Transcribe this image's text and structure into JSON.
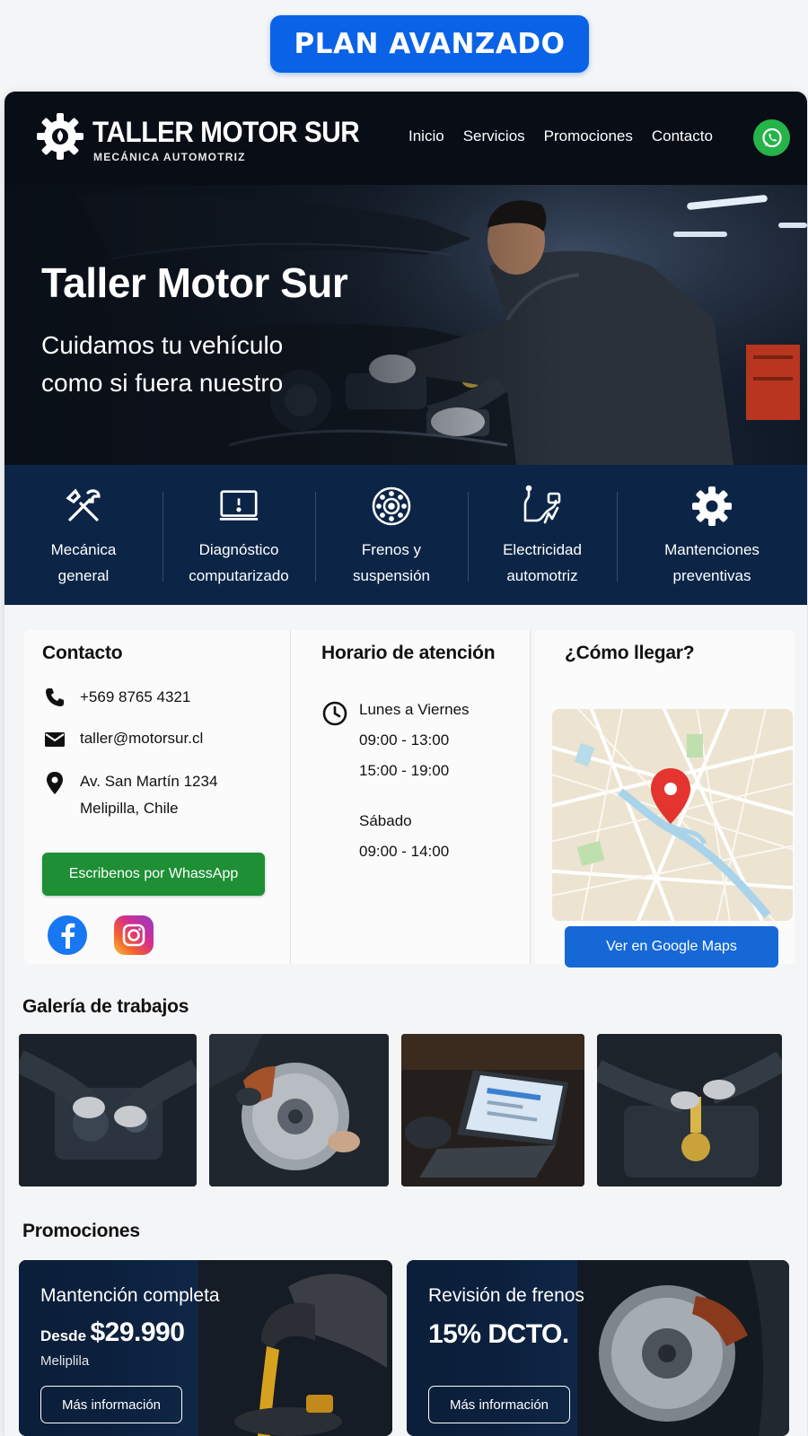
{
  "plan_badge": "PLAN AVANZADO",
  "header": {
    "brand": "TALLER MOTOR SUR",
    "brand_sub": "MECÁNICA AUTOMOTRIZ",
    "nav": [
      "Inicio",
      "Servicios",
      "Promociones",
      "Contacto"
    ],
    "whatsapp_icon": "whatsapp-icon"
  },
  "hero": {
    "title": "Taller Motor Sur",
    "subtitle": "Cuidamos tu vehículo como si fuera nuestro"
  },
  "services": [
    {
      "line1": "Mecánica",
      "line2": "general",
      "icon": "wrench-screwdriver-icon"
    },
    {
      "line1": "Diagnóstico",
      "line2": "computarizado",
      "icon": "laptop-diagnostic-icon"
    },
    {
      "line1": "Frenos y",
      "line2": "suspensión",
      "icon": "brake-disc-icon"
    },
    {
      "line1": "Electricidad",
      "line2": "automotriz",
      "icon": "electrical-wiring-icon"
    },
    {
      "line1": "Mantenciones",
      "line2": "preventivas",
      "icon": "gear-icon"
    }
  ],
  "contact": {
    "title": "Contacto",
    "phone": "+569 8765 4321",
    "email": "taller@motorsur.cl",
    "address_line1": "Av. San Martín 1234",
    "address_line2": "Melipilla, Chile",
    "whatsapp_button": "Escribenos por WhassApp"
  },
  "hours": {
    "title": "Horario de atención",
    "weekdays_label": "Lunes a Viernes",
    "weekdays_morning": "09:00 - 13:00",
    "weekdays_afternoon": "15:00 - 19:00",
    "saturday_label": "Sábado",
    "saturday_hours": "09:00 - 14:00"
  },
  "map": {
    "title": "¿Cómo llegar?",
    "button": "Ver en Google Maps"
  },
  "gallery": {
    "title": "Galería de trabajos"
  },
  "promotions": {
    "title": "Promociones",
    "items": [
      {
        "title": "Mantención completa",
        "desde": "Desde",
        "price": "$29.990",
        "location": "Meliplila",
        "button": "Más información"
      },
      {
        "title": "Revisión de frenos",
        "discount": "15% DCTO.",
        "button": "Más información"
      }
    ]
  },
  "colors": {
    "accent_blue": "#0a63e6",
    "header_bg": "#080d16",
    "services_bg": "#0c2547",
    "whatsapp_green": "#1e8f35",
    "maps_blue": "#1668d6"
  }
}
